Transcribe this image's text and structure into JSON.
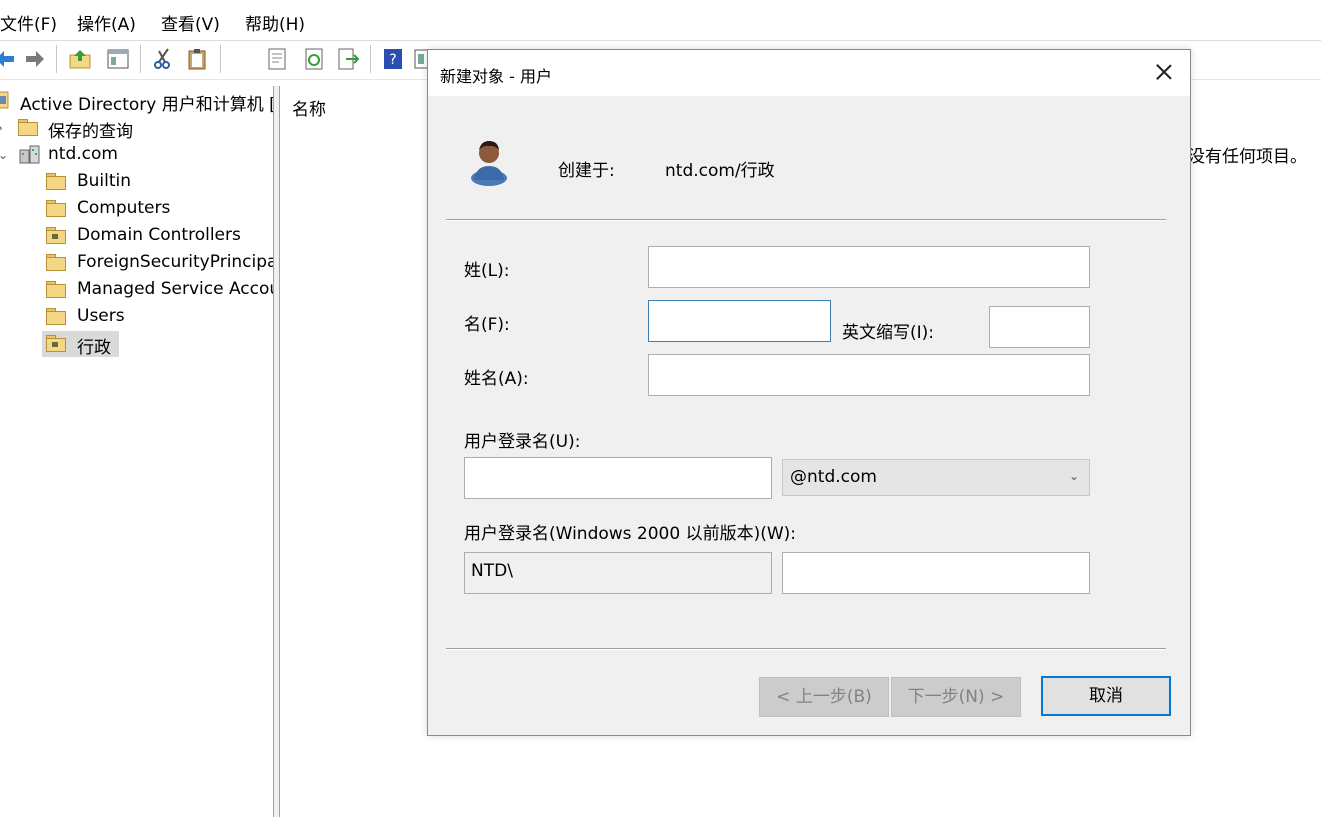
{
  "menu": {
    "file": "文件(F)",
    "action": "操作(A)",
    "view": "查看(V)",
    "help": "帮助(H)"
  },
  "toolbar": {
    "icons": [
      "back-icon",
      "forward-icon",
      "up-folder-icon",
      "console-tree-icon",
      "cut-icon",
      "paste-icon",
      "properties-icon",
      "refresh-icon",
      "export-icon",
      "help-icon",
      "action-pane-icon"
    ]
  },
  "tree": {
    "root": "Active Directory 用户和计算机 [",
    "saved_queries": "保存的查询",
    "domain": "ntd.com",
    "children": [
      "Builtin",
      "Computers",
      "Domain Controllers",
      "ForeignSecurityPrincipal",
      "Managed Service Accou",
      "Users",
      "行政"
    ]
  },
  "list": {
    "header_name": "名称",
    "empty_message": "没有任何项目。"
  },
  "dialog": {
    "title": "新建对象 - 用户",
    "created_in_label": "创建于:",
    "created_in_value": "ntd.com/行政",
    "last_name_label": "姓(L):",
    "first_name_label": "名(F):",
    "initials_label": "英文缩写(I):",
    "full_name_label": "姓名(A):",
    "logon_name_label": "用户登录名(U):",
    "domain_suffix": "@ntd.com",
    "pre2000_label": "用户登录名(Windows 2000 以前版本)(W):",
    "pre2000_prefix": "NTD\\",
    "last_name_value": "",
    "first_name_value": "",
    "initials_value": "",
    "full_name_value": "",
    "logon_name_value": "",
    "pre2000_value": "",
    "back_button": "< 上一步(B)",
    "next_button": "下一步(N) >",
    "cancel_button": "取消"
  }
}
